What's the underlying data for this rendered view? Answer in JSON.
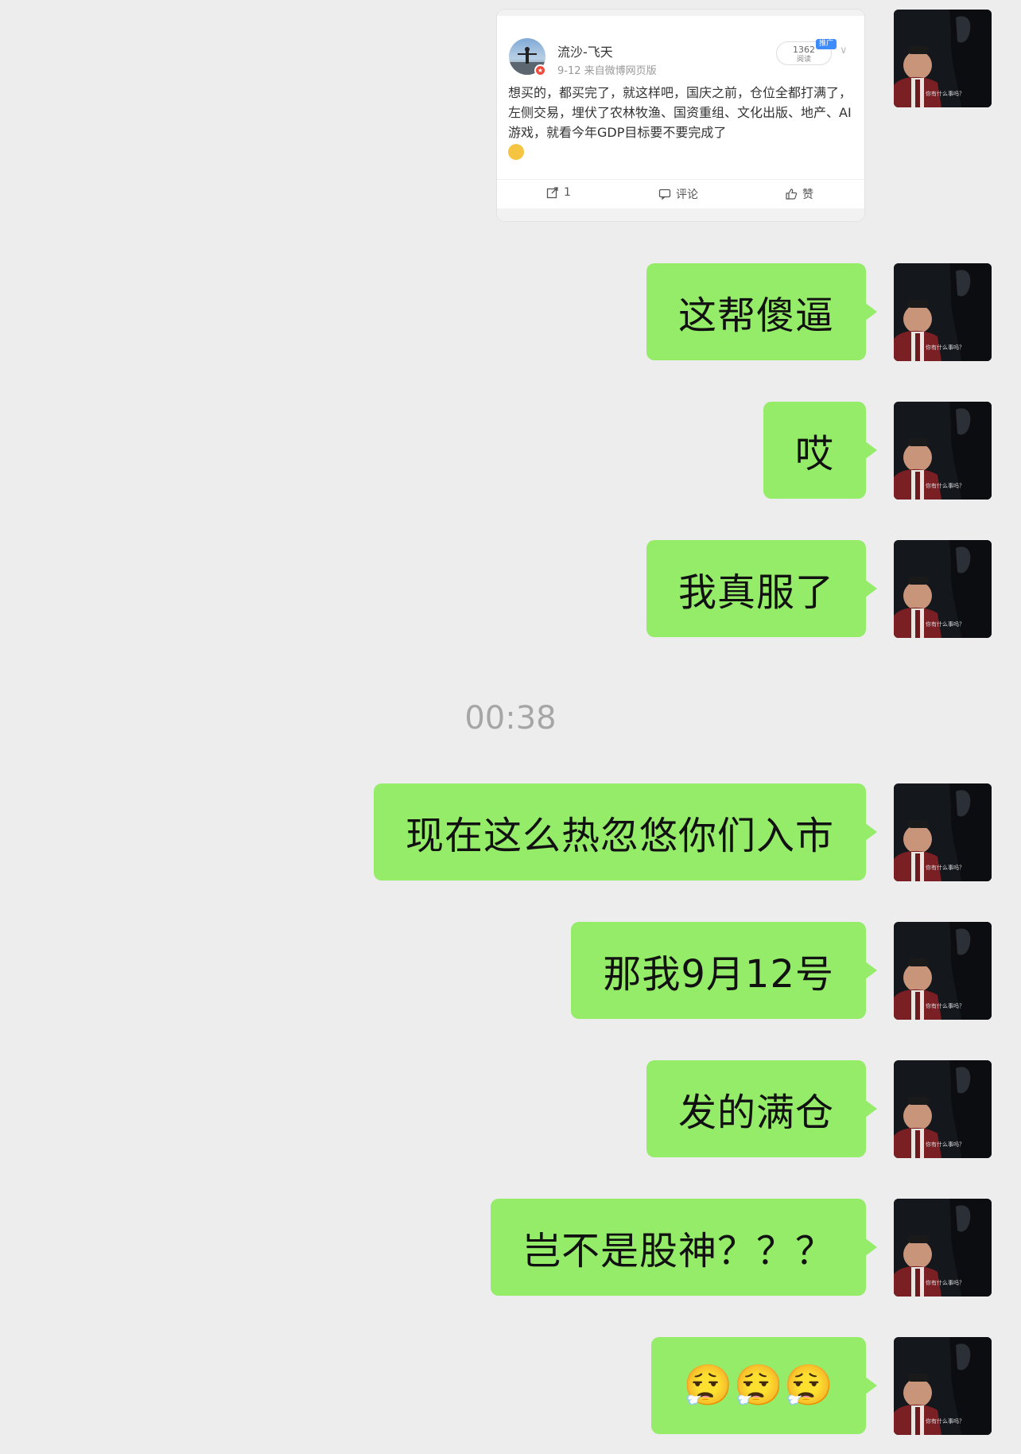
{
  "weibo_card": {
    "username": "流沙-飞天",
    "meta": "9-12  来自微博网页版",
    "read_count": "1362",
    "read_label": "阅读",
    "promo_badge": "推广",
    "body_text": "想买的，都买完了，就这样吧，国庆之前，仓位全都打满了，左侧交易，埋伏了农林牧渔、国资重组、文化出版、地产、AI游戏，就看今年GDP目标要不要完成了",
    "repost_count": "1",
    "comment_label": "评论",
    "like_label": "赞"
  },
  "messages": [
    {
      "text": "这帮傻逼"
    },
    {
      "text": "哎"
    },
    {
      "text": "我真服了"
    },
    {
      "text": "现在这么热忽悠你们入市"
    },
    {
      "text": "那我9月12号"
    },
    {
      "text": "发的满仓"
    },
    {
      "text": "岂不是股神？？？"
    },
    {
      "emoji": "😮‍💨😮‍💨😮‍💨"
    }
  ],
  "timestamp": "00:38",
  "avatar_caption": "你有什么事吗？",
  "colors": {
    "background": "#ededed",
    "bubble": "#95ec69",
    "timestamp": "#a6a6a6"
  }
}
